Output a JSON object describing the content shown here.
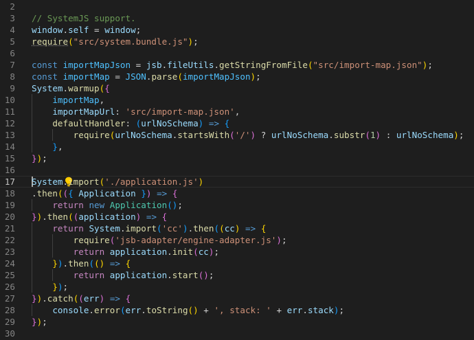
{
  "editor": {
    "active_line": 17,
    "lines": [
      {
        "n": "2",
        "code": ""
      },
      {
        "n": "3",
        "code": ""
      },
      {
        "n": "4",
        "code": ""
      },
      {
        "n": "5",
        "code": ""
      },
      {
        "n": "6",
        "code": ""
      },
      {
        "n": "7",
        "code": ""
      },
      {
        "n": "8",
        "code": ""
      },
      {
        "n": "9",
        "code": ""
      },
      {
        "n": "10",
        "code": ""
      },
      {
        "n": "11",
        "code": ""
      },
      {
        "n": "12",
        "code": ""
      },
      {
        "n": "13",
        "code": ""
      },
      {
        "n": "14",
        "code": ""
      },
      {
        "n": "15",
        "code": ""
      },
      {
        "n": "16",
        "code": ""
      },
      {
        "n": "17",
        "code": ""
      },
      {
        "n": "18",
        "code": ""
      },
      {
        "n": "19",
        "code": ""
      },
      {
        "n": "20",
        "code": ""
      },
      {
        "n": "21",
        "code": ""
      },
      {
        "n": "22",
        "code": ""
      },
      {
        "n": "23",
        "code": ""
      },
      {
        "n": "24",
        "code": ""
      },
      {
        "n": "25",
        "code": ""
      },
      {
        "n": "26",
        "code": ""
      },
      {
        "n": "27",
        "code": ""
      },
      {
        "n": "28",
        "code": ""
      },
      {
        "n": "29",
        "code": ""
      },
      {
        "n": "30",
        "code": ""
      }
    ],
    "tokens": {
      "l3_comment": "// SystemJS support.",
      "l4_window1": "window",
      "l4_self": "self",
      "l4_eq": " = ",
      "l4_window2": "window",
      "l4_semi": ";",
      "l5_require": "require",
      "l5_str": "\"src/system.bundle.js\"",
      "l7_const": "const",
      "l7_name": "importMapJson",
      "l7_jsb": "jsb",
      "l7_fileUtils": "fileUtils",
      "l7_fn": "getStringFromFile",
      "l7_str": "\"src/import-map.json\"",
      "l8_const": "const",
      "l8_name": "importMap",
      "l8_JSON": "JSON",
      "l8_parse": "parse",
      "l8_arg": "importMapJson",
      "l9_System": "System",
      "l9_warmup": "warmup",
      "l10_importMap": "importMap",
      "l11_key": "importMapUrl",
      "l11_str": "'src/import-map.json'",
      "l12_key": "defaultHandler",
      "l12_param": "urlNoSchema",
      "l12_arrow": "=>",
      "l13_require": "require",
      "l13_var1": "urlNoSchema",
      "l13_startsWith": "startsWith",
      "l13_str": "'/'",
      "l13_var2": "urlNoSchema",
      "l13_substr": "substr",
      "l13_num": "1",
      "l13_var3": "urlNoSchema",
      "l17_System": "System",
      "l17_import": "import",
      "l17_str": "'./application.js'",
      "l18_then": "then",
      "l18_param": "Application",
      "l18_arrow": "=>",
      "l19_return": "return",
      "l19_new": "new",
      "l19_cls": "Application",
      "l20_then": "then",
      "l20_param": "application",
      "l20_arrow": "=>",
      "l21_return": "return",
      "l21_System": "System",
      "l21_import": "import",
      "l21_str": "'cc'",
      "l21_then": "then",
      "l21_param": "cc",
      "l21_arrow": "=>",
      "l22_require": "require",
      "l22_str": "'jsb-adapter/engine-adapter.js'",
      "l23_return": "return",
      "l23_app": "application",
      "l23_init": "init",
      "l23_arg": "cc",
      "l24_then": "then",
      "l24_arrow": "=>",
      "l25_return": "return",
      "l25_app": "application",
      "l25_start": "start",
      "l27_catch": "catch",
      "l27_param": "err",
      "l27_arrow": "=>",
      "l28_console": "console",
      "l28_error": "error",
      "l28_err1": "err",
      "l28_toString": "toString",
      "l28_str": "', stack: '",
      "l28_err2": "err",
      "l28_stack": "stack"
    }
  }
}
